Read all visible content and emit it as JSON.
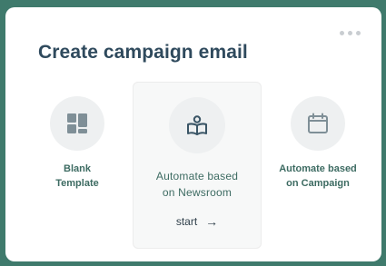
{
  "dialog": {
    "title": "Create campaign email",
    "more_icon": "more-horizontal-icon"
  },
  "options": {
    "blank": {
      "line1": "Blank",
      "line2": "Template",
      "icon": "layout-grid-icon"
    },
    "newsroom": {
      "line1": "Automate based",
      "line2": "on Newsroom",
      "icon": "book-reader-icon",
      "action_label": "start",
      "action_icon": "arrow-right-icon"
    },
    "campaign": {
      "line1": "Automate based",
      "line2": "on Campaign",
      "icon": "calendar-icon"
    }
  },
  "colors": {
    "background": "#3f7a6c",
    "title": "#2f4a5d",
    "accent": "#3d6b62",
    "icon_circle": "#eef0f1"
  }
}
